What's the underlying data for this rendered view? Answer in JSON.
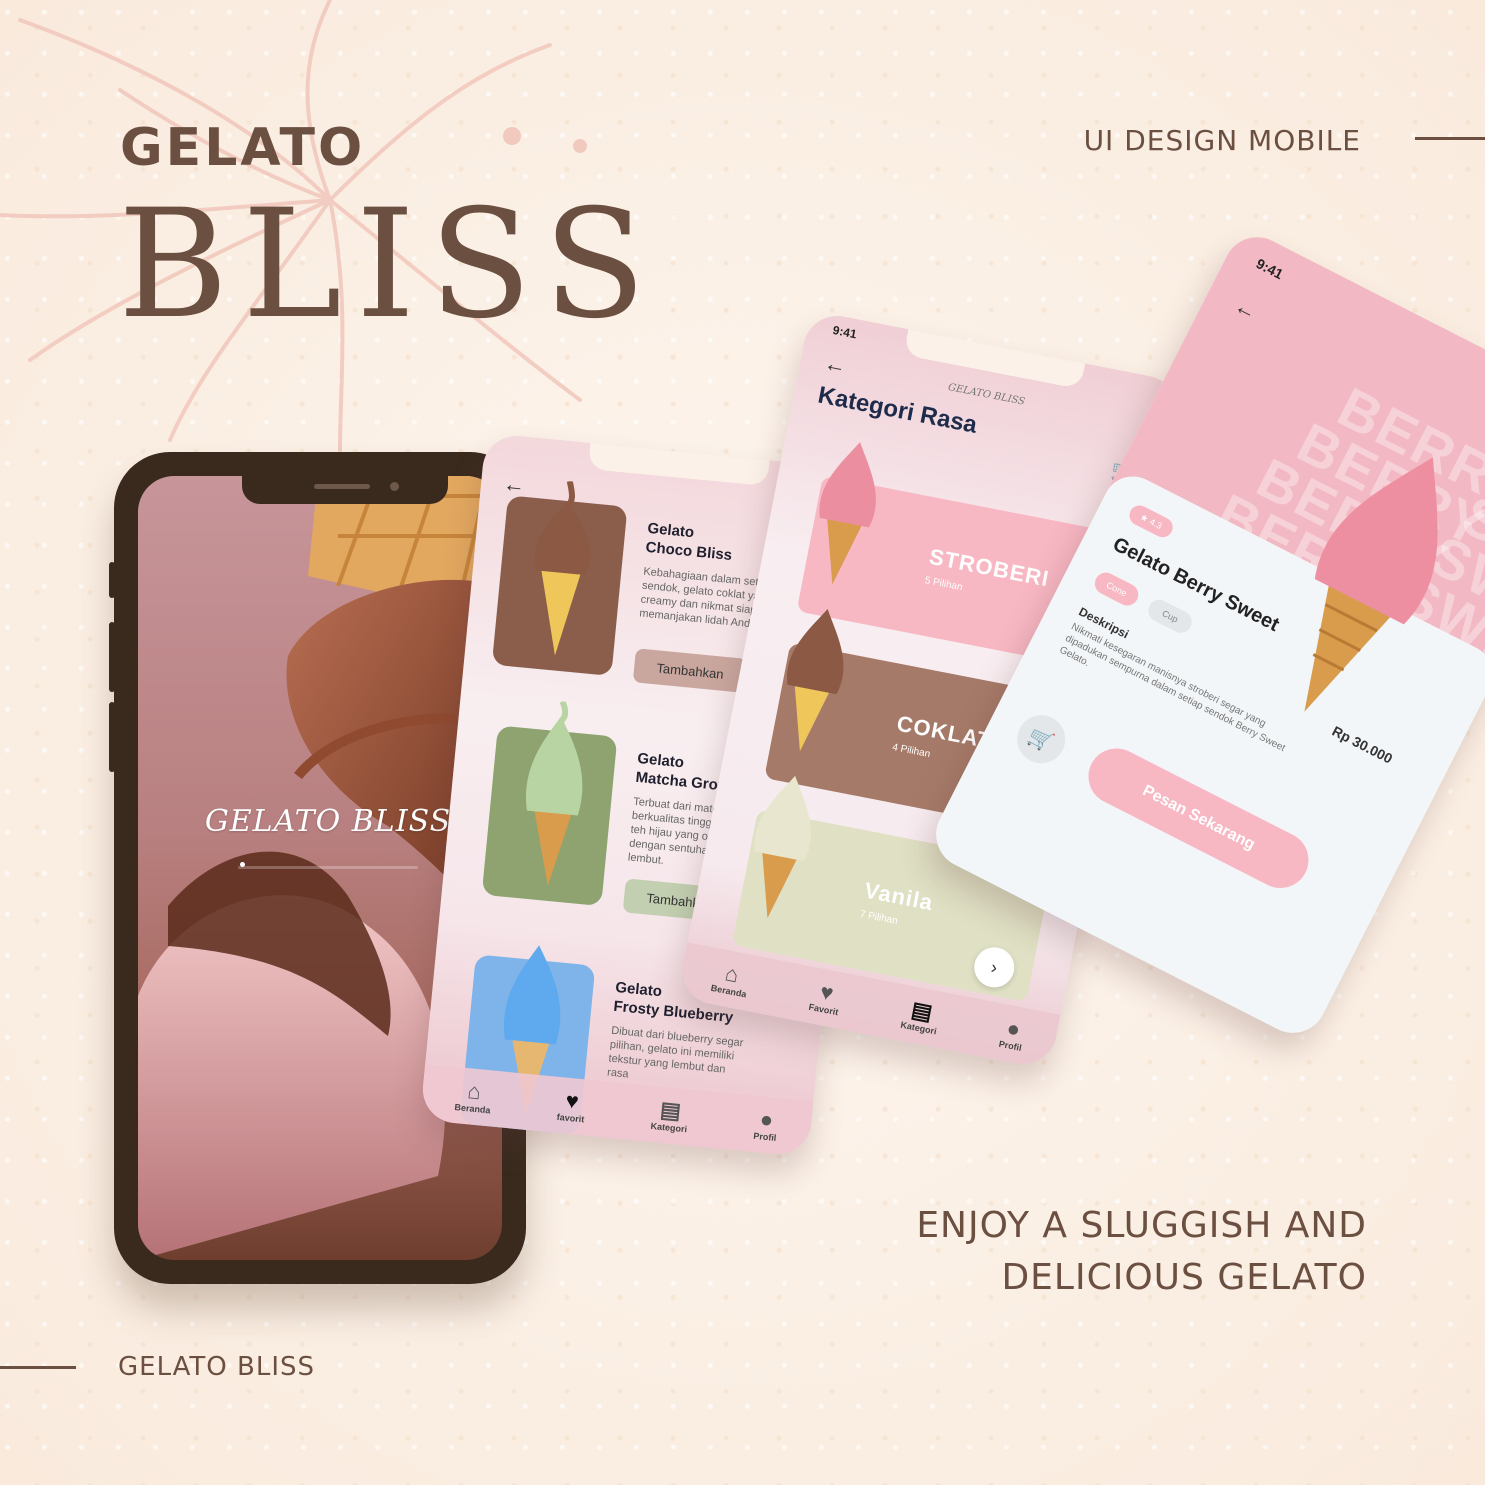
{
  "header": {
    "brand_line1": "GELATO",
    "brand_line2": "BLISS",
    "subtitle": "UI DESIGN MOBILE"
  },
  "footer": {
    "brand": "GELATO BLISS",
    "slogan_line1": "ENJOY A SLUGGISH AND",
    "slogan_line2": "DELICIOUS GELATO"
  },
  "colors": {
    "brown": "#6b4f40",
    "pink": "#f7b7c3",
    "coklat": "#a67a68",
    "matcha": "#8ea36f",
    "blueberry": "#7fb4ea",
    "vanila": "#dfe0c4"
  },
  "splash": {
    "title": "GELATO BLISS"
  },
  "list_screen": {
    "items": [
      {
        "title_line1": "Gelato",
        "title_line2": "Choco Bliss",
        "desc": "Kebahagiaan dalam setiap sendok, gelato coklat yang creamy dan nikmat siap memanjakan lidah Anda.",
        "button": "Tambahkan"
      },
      {
        "title_line1": "Gelato",
        "title_line2": "Matcha Grove",
        "desc": "Terbuat dari matcha berkualitas tinggi,menu rasa teh hijau yang otentik dengan sentuhan manis lembut.",
        "button": "Tambahkan"
      },
      {
        "title_line1": "Gelato",
        "title_line2": "Frosty Blueberry",
        "desc": "Dibuat dari blueberry segar pilihan, gelato ini memiliki tekstur yang lembut dan rasa"
      }
    ],
    "tabs": [
      {
        "label": "Beranda",
        "icon": "home-icon"
      },
      {
        "label": "favorit",
        "icon": "heart-icon"
      },
      {
        "label": "Kategori",
        "icon": "clipboard-icon"
      },
      {
        "label": "Profil",
        "icon": "user-icon"
      }
    ]
  },
  "category_screen": {
    "time": "9:41",
    "logo": "GELATO BLISS",
    "heading": "Kategori Rasa",
    "categories": [
      {
        "name": "STROBERI",
        "count": "5 Pilihan"
      },
      {
        "name": "COKLAT",
        "count": "4 Pilihan"
      },
      {
        "name": "Vanila",
        "count": "7 Pilihan"
      }
    ],
    "tabs": [
      {
        "label": "Beranda",
        "icon": "home-icon"
      },
      {
        "label": "Favorit",
        "icon": "heart-icon"
      },
      {
        "label": "Kategori",
        "icon": "clipboard-icon"
      },
      {
        "label": "Profil",
        "icon": "user-icon"
      }
    ]
  },
  "detail_screen": {
    "time": "9:41",
    "bg_words": [
      "BERRY",
      "BERRY",
      "BERRY",
      "BERRY",
      "SWEET",
      "SWEET",
      "SWEET"
    ],
    "rating": "4.3",
    "title": "Gelato Berry Sweet",
    "options": [
      "Cone",
      "Cup"
    ],
    "price": "Rp 30.000",
    "desc_heading": "Deskripsi",
    "desc": "Nikmati kesegaran manisnya stroberi segar yang dipadukan sempurna dalam setiap sendok Berry Sweet Gelato.",
    "order_button": "Pesan Sekarang"
  }
}
